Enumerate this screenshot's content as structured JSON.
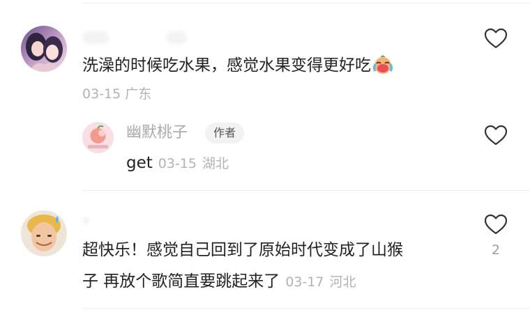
{
  "comments": [
    {
      "text": "洗澡的时候吃水果，感觉水果变得更好吃",
      "emoji": "crying-laughing-face-emoji",
      "date": "03-15",
      "location": "广东",
      "reply": {
        "author": "幽默桃子",
        "author_badge": "作者",
        "text": "get",
        "date": "03-15",
        "location": "湖北"
      }
    },
    {
      "text_line1": "超快乐！感觉自己回到了原始时代变成了山猴",
      "text_line2": "子 再放个歌简直要跳起来了",
      "date": "03-17",
      "location": "河北",
      "likes": "2"
    }
  ],
  "icons": {
    "like": "heart-outline-icon"
  },
  "colors": {
    "text": "#222222",
    "meta": "#b2b2b2",
    "badge_bg": "#f2f2f2",
    "divider": "#eeeeee"
  }
}
